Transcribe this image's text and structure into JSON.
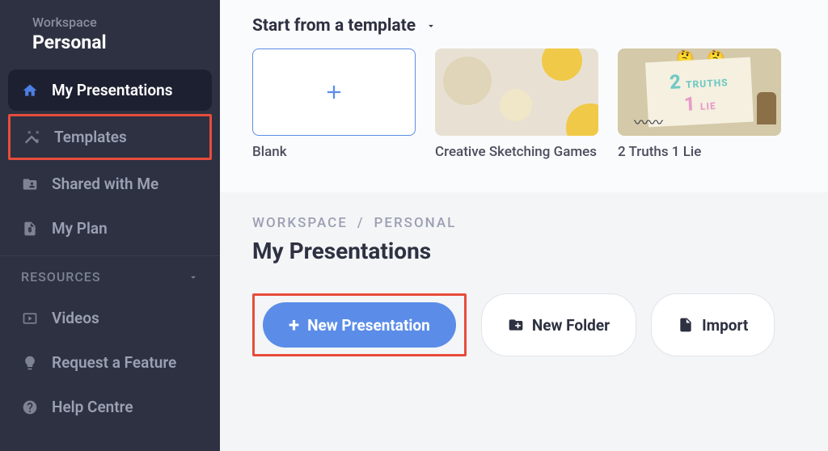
{
  "workspace": {
    "label": "Workspace",
    "name": "Personal"
  },
  "sidebar": {
    "items": [
      {
        "label": "My Presentations",
        "icon": "home"
      },
      {
        "label": "Templates",
        "icon": "wand"
      },
      {
        "label": "Shared with Me",
        "icon": "folder-shared"
      },
      {
        "label": "My Plan",
        "icon": "file-dollar"
      }
    ],
    "section_header": "RESOURCES",
    "resources": [
      {
        "label": "Videos",
        "icon": "video"
      },
      {
        "label": "Request a Feature",
        "icon": "bulb"
      },
      {
        "label": "Help Centre",
        "icon": "help"
      }
    ]
  },
  "templates": {
    "header": "Start from a template",
    "cards": [
      {
        "name": "Blank"
      },
      {
        "name": "Creative Sketching Games"
      },
      {
        "name": "2 Truths 1 Lie"
      }
    ]
  },
  "breadcrumb": {
    "workspace": "WORKSPACE",
    "sep": "/",
    "current": "PERSONAL"
  },
  "page_title": "My Presentations",
  "actions": {
    "new_presentation": "New Presentation",
    "new_folder": "New Folder",
    "import": "Import"
  },
  "truths_content": {
    "num_truths": "2",
    "truths_word": "TRUTHS",
    "num_lie": "1",
    "lie_word": "LIE"
  }
}
